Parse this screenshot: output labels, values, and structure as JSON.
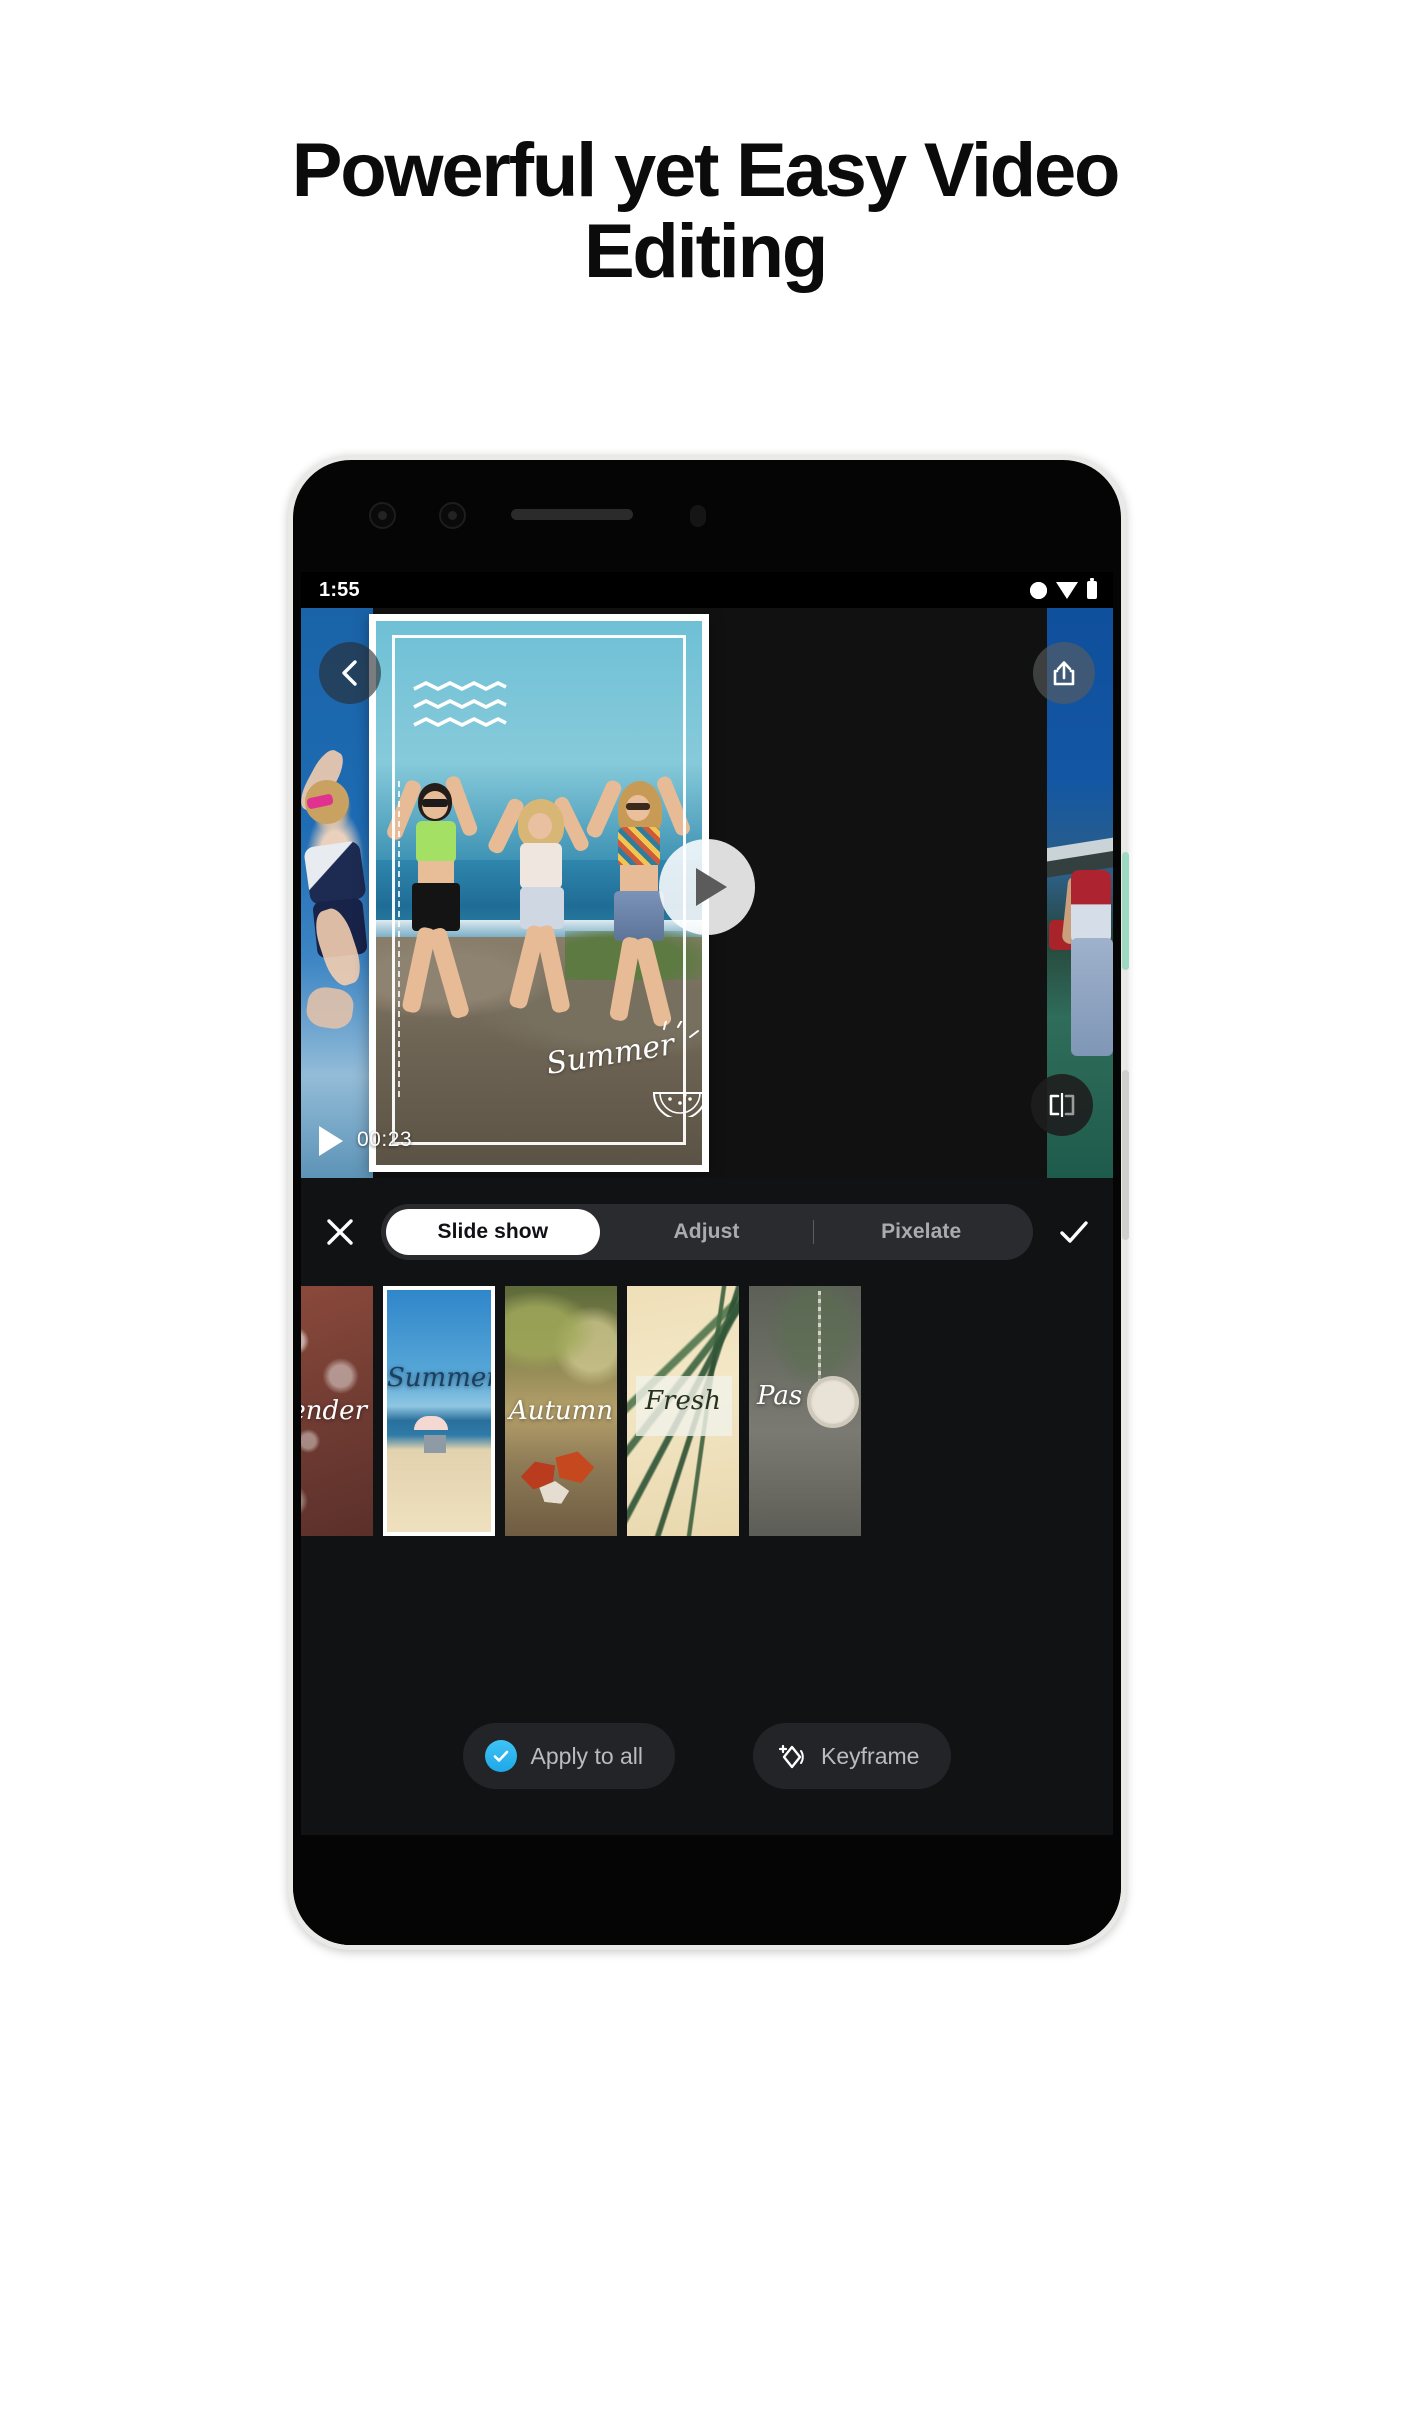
{
  "headline": {
    "line1": "Powerful yet Easy Video",
    "line2": "Editing"
  },
  "phone": {
    "statusbar": {
      "time": "1:55",
      "icons": [
        "contrast-icon",
        "wifi-icon",
        "battery-icon"
      ]
    },
    "navbar": {
      "back_icon": "chevron-left-icon",
      "home_pill": "home-pill"
    }
  },
  "player": {
    "back_icon": "chevron-left-icon",
    "share_icon": "share-export-icon",
    "compare_icon": "compare-split-icon",
    "play_icon": "play-icon",
    "mini_play_icon": "play-icon",
    "timecode": "00:23",
    "overlay_text": "Summer",
    "decor": {
      "waves": "wave-lines-decoration",
      "watermelon": "watermelon-slice-doodle"
    }
  },
  "editor": {
    "close_label": "close-icon",
    "confirm_label": "check-icon",
    "tabs": [
      {
        "label": "Slide show",
        "active": true
      },
      {
        "label": "Adjust",
        "active": false
      },
      {
        "label": "Pixelate",
        "active": false
      }
    ],
    "thumbnails": [
      {
        "label": "Tender",
        "selected": false
      },
      {
        "label": "Summer",
        "selected": true
      },
      {
        "label": "Autumn",
        "selected": false
      },
      {
        "label": "Fresh",
        "selected": false
      },
      {
        "label": "Pas",
        "selected": false
      }
    ],
    "actions": [
      {
        "label": "Apply to all",
        "icon": "check-circle-icon"
      },
      {
        "label": "Keyframe",
        "icon": "keyframe-diamond-icon"
      }
    ]
  },
  "colors": {
    "accent_blue": "#28b0e6",
    "panel_bg": "#111214",
    "tab_group_bg": "#2a2b2e",
    "tab_active_bg": "#ffffff",
    "power_button": "#9ed9c2"
  }
}
